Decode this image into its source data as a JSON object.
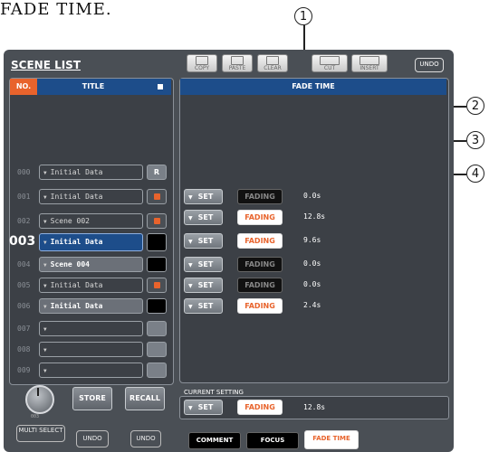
{
  "caption": "FADE TIME.",
  "callouts": [
    "1",
    "2",
    "3",
    "4"
  ],
  "window": {
    "title": "SCENE LIST"
  },
  "toolbar": {
    "copy": "COPY",
    "paste": "PASTE",
    "clear": "CLEAR",
    "cut": "CUT",
    "insert": "INSERT",
    "undo": "UNDO"
  },
  "list": {
    "headers": {
      "no": "NO.",
      "title": "TITLE"
    },
    "rows": [
      {
        "no": "000",
        "title": "Initial Data",
        "status": "R"
      },
      {
        "no": "001",
        "title": "Initial Data",
        "status": "lock"
      },
      {
        "no": "002",
        "title": "Scene 002",
        "status": "lock"
      },
      {
        "no": "003",
        "title": "Initial Data",
        "status": "black"
      },
      {
        "no": "004",
        "title": "Scene 004",
        "status": "black"
      },
      {
        "no": "005",
        "title": "Initial Data",
        "status": "lock"
      },
      {
        "no": "006",
        "title": "Initial Data",
        "status": "black"
      },
      {
        "no": "007",
        "title": "",
        "status": "empty"
      },
      {
        "no": "008",
        "title": "",
        "status": "empty"
      },
      {
        "no": "009",
        "title": "",
        "status": "empty"
      }
    ],
    "status_r_label": "R",
    "knob_value": "003",
    "store": "STORE",
    "recall": "RECALL"
  },
  "bottom_left": {
    "multi_select": "MULTI SELECT",
    "undo1": "UNDO",
    "undo2": "UNDO"
  },
  "fade": {
    "header": "FADE TIME",
    "set_label": "SET",
    "fading_label": "FADING",
    "rows": [
      {
        "fading": false,
        "time": "0.0s"
      },
      {
        "fading": true,
        "time": "12.8s"
      },
      {
        "fading": true,
        "time": "9.6s"
      },
      {
        "fading": false,
        "time": "0.0s"
      },
      {
        "fading": false,
        "time": "0.0s"
      },
      {
        "fading": true,
        "time": "2.4s"
      }
    ]
  },
  "current": {
    "label": "CURRENT SETTING",
    "set": "SET",
    "fading": "FADING",
    "time": "12.8s"
  },
  "tabs": {
    "comment": "COMMENT",
    "focus": "FOCUS",
    "fade_time": "FADE TIME"
  },
  "colors": {
    "accent": "#e8632c",
    "header_blue": "#1d4d8a",
    "panel": "#3c4046"
  }
}
